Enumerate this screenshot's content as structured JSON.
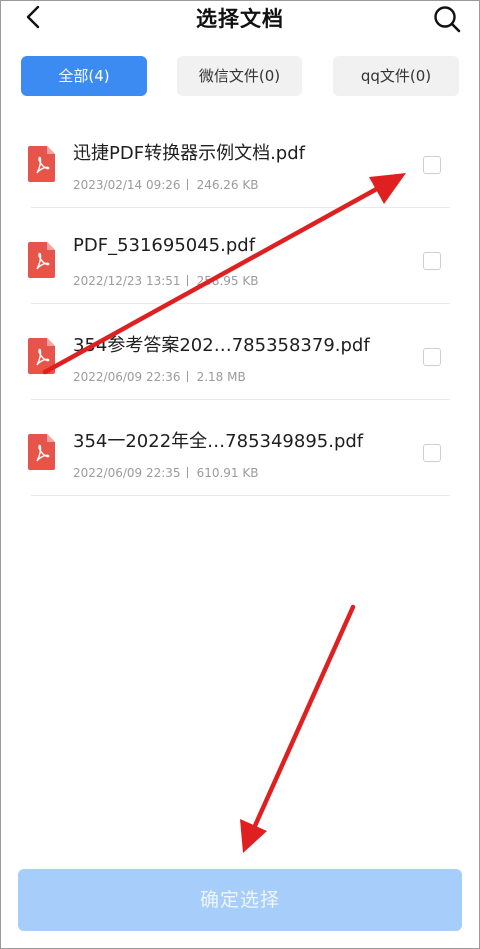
{
  "header": {
    "title": "选择文档"
  },
  "tabs": [
    {
      "label": "全部(4)",
      "active": true
    },
    {
      "label": "微信文件(0)",
      "active": false
    },
    {
      "label": "qq文件(0)",
      "active": false
    }
  ],
  "files": [
    {
      "name": "迅捷PDF转换器示例文档.pdf",
      "date": "2023/02/14 09:26",
      "size": "246.26 KB",
      "checked": false
    },
    {
      "name": "PDF_531695045.pdf",
      "date": "2022/12/23 13:51",
      "size": "258.95 KB",
      "checked": false
    },
    {
      "name": "354参考答案202…785358379.pdf",
      "date": "2022/06/09 22:36",
      "size": "2.18 MB",
      "checked": false
    },
    {
      "name": "354一2022年全…785349895.pdf",
      "date": "2022/06/09 22:35",
      "size": "610.91 KB",
      "checked": false
    }
  ],
  "footer": {
    "confirm_label": "确定选择"
  },
  "colors": {
    "accent": "#3c8bf2",
    "confirm_disabled": "#a7cdfa",
    "pdf_red": "#e8534a",
    "annotation_arrow": "#e02020"
  },
  "icons": {
    "back": "chevron-left-icon",
    "search": "search-icon",
    "file": "pdf-file-icon"
  }
}
